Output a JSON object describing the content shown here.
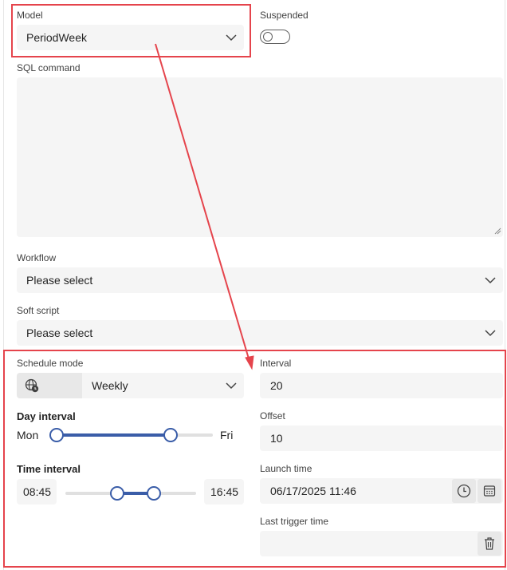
{
  "model": {
    "label": "Model",
    "value": "PeriodWeek"
  },
  "suspended": {
    "label": "Suspended",
    "state": "off"
  },
  "sql": {
    "label": "SQL command",
    "value": ""
  },
  "workflow": {
    "label": "Workflow",
    "value": "Please select"
  },
  "soft_script": {
    "label": "Soft script",
    "value": "Please select"
  },
  "schedule_mode": {
    "label": "Schedule mode",
    "value": "Weekly",
    "icon": "globe-clock-icon"
  },
  "interval": {
    "label": "Interval",
    "value": "20"
  },
  "day_interval": {
    "label": "Day interval",
    "start": "Mon",
    "end": "Fri",
    "range": [
      0,
      0.75
    ]
  },
  "offset": {
    "label": "Offset",
    "value": "10"
  },
  "time_interval": {
    "label": "Time interval",
    "start": "08:45",
    "end": "16:45",
    "range": [
      0.37,
      0.68
    ]
  },
  "launch_time": {
    "label": "Launch time",
    "value": "06/17/2025 11:46"
  },
  "last_trigger_time": {
    "label": "Last trigger time",
    "value": ""
  },
  "colors": {
    "accent": "#3a5da8",
    "annotation": "#e5444c",
    "field_bg": "#f5f5f5"
  }
}
